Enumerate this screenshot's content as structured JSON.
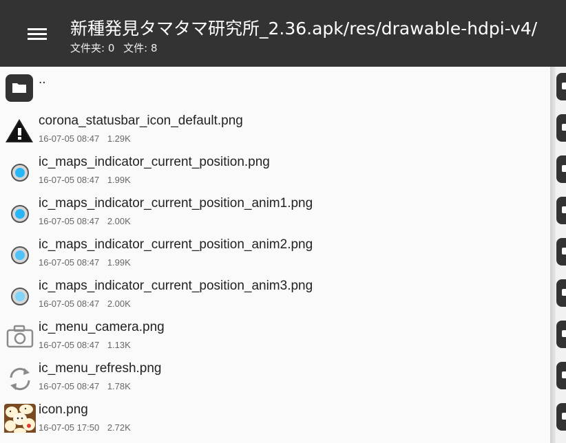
{
  "header": {
    "menu_icon": "hamburger-menu-icon",
    "path": "新種発見タマタマ研究所_2.36.apk/res/drawable-hdpi-v4/",
    "folders_label": "文件夹: 0",
    "files_label": "文件: 8"
  },
  "files": [
    {
      "name": "..",
      "date": "",
      "size": "",
      "icon": "folder-icon"
    },
    {
      "name": "corona_statusbar_icon_default.png",
      "date": "16-07-05 08:47",
      "size": "1.29K",
      "icon": "warning-icon"
    },
    {
      "name": "ic_maps_indicator_current_position.png",
      "date": "16-07-05 08:47",
      "size": "1.99K",
      "icon": "location-dot-icon"
    },
    {
      "name": "ic_maps_indicator_current_position_anim1.png",
      "date": "16-07-05 08:47",
      "size": "2.00K",
      "icon": "location-dot-icon"
    },
    {
      "name": "ic_maps_indicator_current_position_anim2.png",
      "date": "16-07-05 08:47",
      "size": "1.99K",
      "icon": "location-dot-icon"
    },
    {
      "name": "ic_maps_indicator_current_position_anim3.png",
      "date": "16-07-05 08:47",
      "size": "2.00K",
      "icon": "location-dot-icon"
    },
    {
      "name": "ic_menu_camera.png",
      "date": "16-07-05 08:47",
      "size": "1.13K",
      "icon": "camera-icon"
    },
    {
      "name": "ic_menu_refresh.png",
      "date": "16-07-05 08:47",
      "size": "1.78K",
      "icon": "refresh-icon"
    },
    {
      "name": "icon.png",
      "date": "16-07-05 17:50",
      "size": "2.72K",
      "icon": "app-thumbnail-icon"
    }
  ],
  "colors": {
    "appbar": "#333333",
    "background": "#fafafa",
    "indicator_blue": "#29b6f6"
  }
}
